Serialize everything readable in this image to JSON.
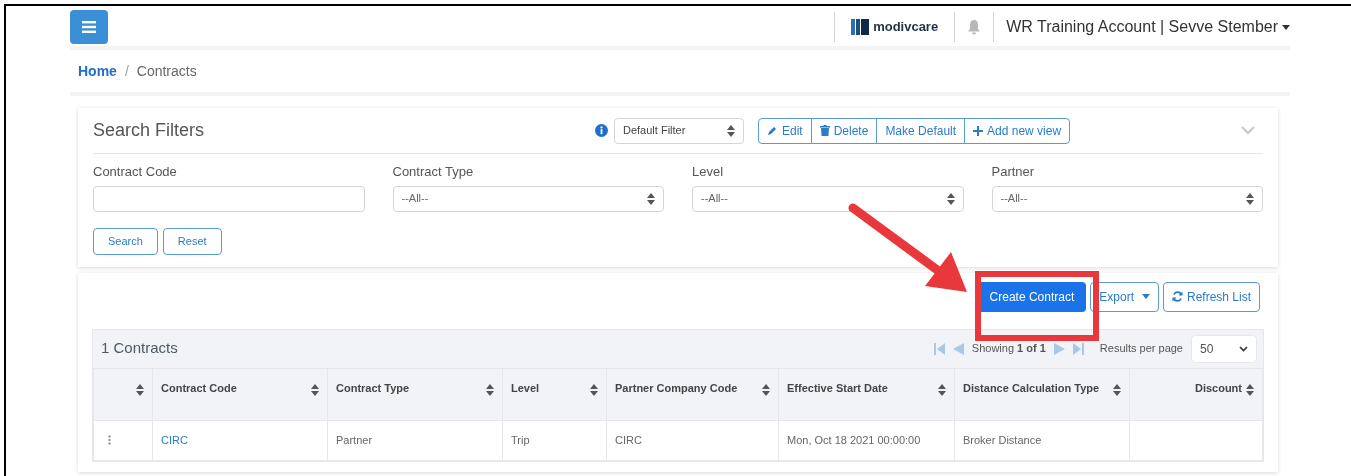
{
  "header": {
    "logo_text": "modivcare",
    "account": "WR Training Account | Sevve Stember"
  },
  "breadcrumb": [
    {
      "label": "Home",
      "kind": "link"
    },
    {
      "label": "/",
      "kind": "separator"
    },
    {
      "label": "Contracts",
      "kind": "current"
    }
  ],
  "search_filters": {
    "title": "Search Filters",
    "view_select": "Default Filter",
    "view_actions": [
      {
        "label": "Edit",
        "kind": "edit"
      },
      {
        "label": "Delete",
        "kind": "delete"
      },
      {
        "label": "Make Default",
        "kind": "plain"
      },
      {
        "label": "Add new view",
        "kind": "add"
      }
    ],
    "fields": [
      {
        "label": "Contract Code",
        "kind": "input"
      },
      {
        "label": "Contract Type",
        "kind": "select",
        "value": "--All--"
      },
      {
        "label": "Level",
        "kind": "select",
        "value": "--All--"
      },
      {
        "label": "Partner",
        "kind": "select",
        "value": "--All--"
      }
    ],
    "buttons": [
      "Search",
      "Reset"
    ]
  },
  "toolbar": [
    {
      "label": "Create Contract",
      "kind": "primary"
    },
    {
      "label": "Export",
      "kind": "dropdown"
    },
    {
      "label": "Refresh List",
      "kind": "refresh"
    }
  ],
  "table": {
    "title": "1 Contracts",
    "pager": {
      "prefix": "Showing",
      "page": "1 of 1",
      "per_page_label": "Results per page",
      "per_page": "50"
    },
    "columns": [
      "Contract Code",
      "Contract Type",
      "Level",
      "Partner Company Code",
      "Effective Start Date",
      "Distance Calculation Type",
      "Discount"
    ],
    "rows": [
      {
        "cells": [
          "CIRC",
          "Partner",
          "Trip",
          "CIRC",
          "Mon, Oct 18 2021 00:00:00",
          "Broker Distance",
          ""
        ]
      }
    ]
  }
}
